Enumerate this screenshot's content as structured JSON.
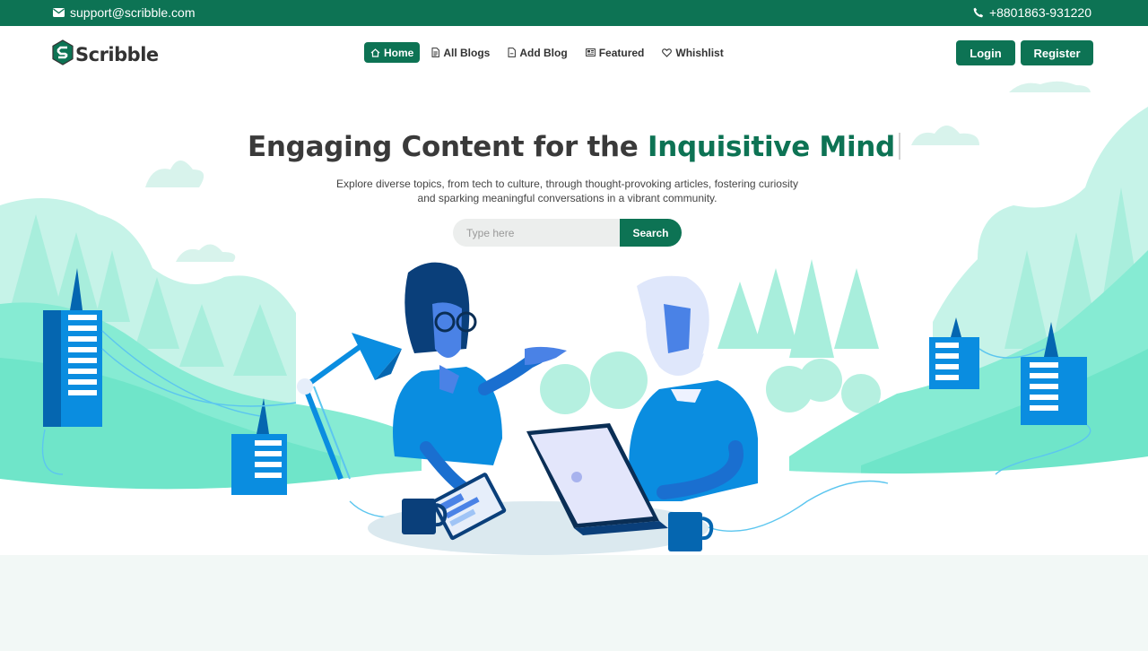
{
  "topbar": {
    "email": "support@scribble.com",
    "phone": "+8801863-931220",
    "email_icon": "envelope-icon",
    "phone_icon": "phone-icon"
  },
  "brand": {
    "name": "Scribble",
    "logo_icon": "s-hexagon-logo"
  },
  "nav": {
    "items": [
      {
        "label": "Home",
        "icon": "home-icon",
        "active": true
      },
      {
        "label": "All Blogs",
        "icon": "document-icon",
        "active": false
      },
      {
        "label": "Add Blog",
        "icon": "file-icon",
        "active": false
      },
      {
        "label": "Featured",
        "icon": "newspaper-icon",
        "active": false
      },
      {
        "label": "Whishlist",
        "icon": "heart-icon",
        "active": false
      }
    ]
  },
  "auth": {
    "login_label": "Login",
    "register_label": "Register"
  },
  "hero": {
    "title_main": "Engaging Content for the ",
    "title_accent": "Inquisitive Mind",
    "subtitle_line1": "Explore diverse topics, from tech to culture, through thought-provoking articles, fostering curiosity",
    "subtitle_line2": "and sparking meaningful conversations in a vibrant community.",
    "search_placeholder": "Type here",
    "search_button": "Search"
  },
  "colors": {
    "primary": "#0d7354",
    "mint": "#7ee8cf",
    "blue": "#0a8de0"
  }
}
